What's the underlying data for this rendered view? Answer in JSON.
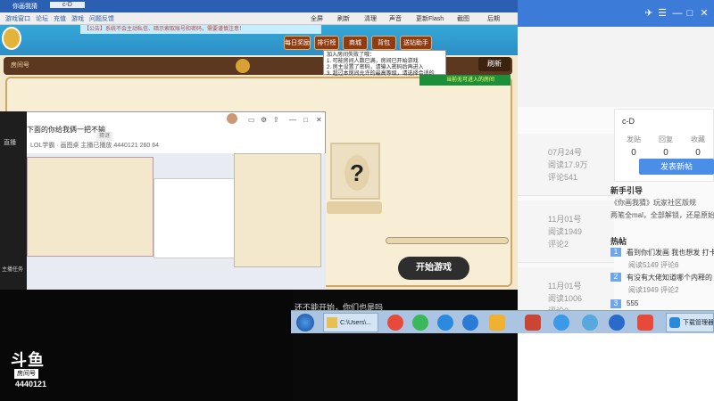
{
  "browser_bg": {
    "title_icons": [
      "bird-icon",
      "grid-icon",
      "minimize-icon",
      "maximize-icon",
      "close-icon"
    ],
    "user": {
      "name": "c-D",
      "stats": [
        {
          "label": "发贴",
          "value": "0"
        },
        {
          "label": "回复",
          "value": "0"
        },
        {
          "label": "收藏",
          "value": "0"
        }
      ],
      "post_button": "发表新帖"
    },
    "posts": [
      {
        "date": "07月24号",
        "views": "阅读17.9万",
        "comments": "评论541"
      },
      {
        "date": "11月01号",
        "views": "阅读1949",
        "comments": "评论2"
      },
      {
        "date": "11月01号",
        "views": "阅读1006",
        "comments": "评论0"
      }
    ],
    "guide_title": "新手引导",
    "guide_text": "《你画我猜》玩家社区版规",
    "guide_text2": "两笔全mal，全部解锁，还是原始",
    "hot_title": "热帖",
    "hot": [
      {
        "n": "1",
        "title": "看到你们发画 我也想发 打卡",
        "views": "阅读5149",
        "comments": "评论6"
      },
      {
        "n": "2",
        "title": "有没有大佬知道哪个内释的",
        "views": "阅读1949",
        "comments": "评论2"
      },
      {
        "n": "3",
        "title": "555",
        "views": "",
        "comments": ""
      }
    ]
  },
  "game": {
    "window_tab": "你画我猜",
    "tab2": "c-D",
    "menu": [
      "游戏窗口",
      "论坛",
      "充值",
      "游戏",
      "问题反馈"
    ],
    "toolbar": [
      "全屏",
      "刷新",
      "清理",
      "声音",
      "更新Flash",
      "截图",
      "后期"
    ],
    "marquee": "【公告】系统不会主动私信、暗示索取账号和密码，需要谨慎注意！",
    "nav": [
      "每日奖励",
      "排行榜",
      "商城",
      "背包",
      "送钻助手"
    ],
    "selector_text": "房间号",
    "refresh_button": "刷新",
    "popup_lines": [
      "加入房间失败了哦：",
      "1. 可能房间人数已满，房间已开始游戏",
      "2. 房主设置了密码，请输入密码后再进入",
      "3. 超过本房间允许的最高等级，请选择合适的"
    ],
    "room_tip": "当前无可进入的房间",
    "start_button": "开始游戏",
    "card_mark": "?"
  },
  "douyu": {
    "title": "下面的你给我俩一把不输",
    "tag": "猜谜",
    "sub": [
      "LOL学霸 · 画图桌",
      "主播已播放",
      "4440121",
      "260",
      "64"
    ],
    "sidebar": [
      "直播",
      "主播任务"
    ]
  },
  "taskbar": {
    "explorer": "C:\\Users\\...",
    "last": "下载管理器"
  },
  "chat": "还不能开始，你们也是吗",
  "watermark": {
    "logo": "斗鱼",
    "room_label": "房间号",
    "room_number": "4440121"
  }
}
